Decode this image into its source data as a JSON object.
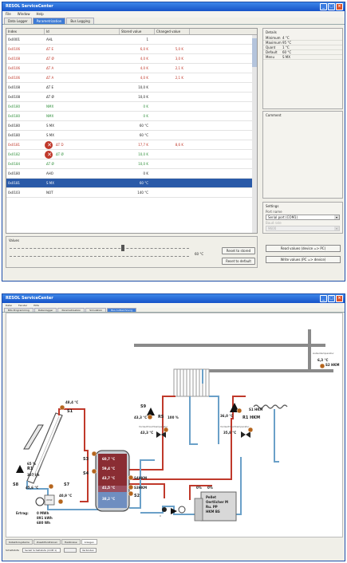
{
  "win1": {
    "title": "RESOL ServiceCenter",
    "menu": [
      "File",
      "Window",
      "Help"
    ],
    "tabs": [
      "Data Logger",
      "Parametrization",
      "Bus Logging"
    ],
    "active_tab": 1,
    "grid": {
      "headers": [
        "Index",
        "Id",
        "Stored value",
        "Changed value"
      ],
      "rows": [
        {
          "index": "0x0001",
          "id": "AHL",
          "stored": "1",
          "changed": "",
          "style": "normal"
        },
        {
          "index": "0x0106",
          "id": "ΔT E",
          "stored": "6,0 K",
          "changed": "5,0 K",
          "style": "red"
        },
        {
          "index": "0x0108",
          "id": "ΔT Ø",
          "stored": "4,0 K",
          "changed": "3,0 K",
          "style": "red"
        },
        {
          "index": "0x0106",
          "id": "ΔT A",
          "stored": "4,0 K",
          "changed": "2,1 K",
          "style": "red"
        },
        {
          "index": "0x0106",
          "id": "ΔT A",
          "stored": "4,0 K",
          "changed": "2,1 K",
          "style": "red"
        },
        {
          "index": "0x0108",
          "id": "ΔT E",
          "stored": "10,0 K",
          "changed": "",
          "style": "normal"
        },
        {
          "index": "0x0108",
          "id": "ΔT Ø",
          "stored": "10,0 K",
          "changed": "",
          "style": "normal"
        },
        {
          "index": "0x0180",
          "id": "NMX",
          "stored": "0 K",
          "changed": "",
          "style": "green"
        },
        {
          "index": "0x0180",
          "id": "NMX",
          "stored": "0 K",
          "changed": "",
          "style": "green"
        },
        {
          "index": "0x0180",
          "id": "S MX",
          "stored": "60 °C",
          "changed": "",
          "style": "normal"
        },
        {
          "index": "0x0180",
          "id": "S MX",
          "stored": "60 °C",
          "changed": "",
          "style": "normal"
        },
        {
          "index": "0x0181",
          "id": "ΔT D",
          "stored": "17,7 K",
          "changed": "8,6 K",
          "style": "red",
          "error": true
        },
        {
          "index": "0x0182",
          "id": "ΔT Ø",
          "stored": "10,0 K",
          "changed": "",
          "style": "green",
          "error": true
        },
        {
          "index": "0x0184",
          "id": "ΔT Ø",
          "stored": "10,0 K",
          "changed": "",
          "style": "green"
        },
        {
          "index": "0x0180",
          "id": "AHO",
          "stored": "0 K",
          "changed": "",
          "style": "normal"
        },
        {
          "index": "0x0181",
          "id": "S MX",
          "stored": "60 °C",
          "changed": "",
          "style": "sel"
        },
        {
          "index": "0x0103",
          "id": "NOT",
          "stored": "140 °C",
          "changed": "",
          "style": "normal"
        }
      ]
    },
    "details": {
      "title": "Details",
      "items": [
        {
          "k": "Minimum",
          "v": "4 °C"
        },
        {
          "k": "Maximum",
          "v": "95 °C"
        },
        {
          "k": "Quant",
          "v": "1 °C"
        },
        {
          "k": "Default",
          "v": "60 °C"
        },
        {
          "k": "Menu",
          "v": "S MX"
        }
      ]
    },
    "comment_title": "Comment",
    "settings": {
      "title": "Settings",
      "port_label": "Port name",
      "port_value": "Serial port (COM1)",
      "baud_label": "Baud rate",
      "baud_value": "9600",
      "read_btn": "Read values (device => PC)",
      "write_btn": "Write values (PC => device)"
    },
    "values": {
      "title": "Values",
      "slider_value": "60 °C",
      "reset_stored": "Reset to stored",
      "reset_default": "Reset to default"
    }
  },
  "win2": {
    "title": "RESOL ServiceCenter",
    "menu": [
      "Datei",
      "Fenster",
      "Hilfe"
    ],
    "tabs": [
      "Bits Programming",
      "Datenlogger",
      "Parametrisation",
      "Simulation",
      "Bus Aufzeichnung"
    ],
    "active_tab": 4,
    "diagram": {
      "s1_temp": "48,4 °C",
      "s1": "S1",
      "r1_pct": "65 %",
      "r1": "R1",
      "r1_flow": "307 l/h",
      "s8": "S8",
      "s8_temp": "45,6 °C",
      "s7": "S7",
      "s7_temp": "40,9 °C",
      "wmz_label": "WMZ",
      "ertrag_label": "Ertrag:",
      "ertrag_values": [
        "0 MWh",
        "891 kWh",
        "680 Wh"
      ],
      "s3": "S3",
      "s4": "S4",
      "tank_temps": [
        "60,7 °C",
        "59,4 °C",
        "43,7 °C",
        "41,5 °C",
        "38,2 °C"
      ],
      "s4hkm": "S4HKM",
      "s3hkm": "S3HKM",
      "s2": "S2",
      "s9": "S9",
      "s9_temp": "43,3 °C",
      "r5": "R5",
      "r5_pct": "100 %",
      "left_mix_label": "Vorlaufmischtemperatur",
      "left_mix_temp": "43,3 °C",
      "s1hkm": "S1 HKM",
      "s1hkm_temp": "36,0 °C",
      "r1hkm": "R1 HKM",
      "right_mix_label": "Vorlaufmischtemperatur",
      "right_mix_temp": "35,8 °C",
      "outside_label": "Außentemperatur",
      "outside_temp": "6,3 °C",
      "s2hkm": "S2 HKM",
      "boiler_lines": [
        "Pellet",
        "Oertlicher M",
        "Ru. PP",
        "HKM BS"
      ],
      "boiler_pct": [
        "0%",
        "0%"
      ],
      "small_zero": "0"
    },
    "bottom_tabs": [
      "Kollektorsysteme",
      "Zusatzfunktionen",
      "Heizkreise",
      "Anlagen"
    ],
    "active_bottom_tab": 3,
    "status": {
      "label": "Schaltstufe",
      "value": "Seriell Schaltstufe (COM 1)",
      "btn": "Verbinden"
    }
  }
}
